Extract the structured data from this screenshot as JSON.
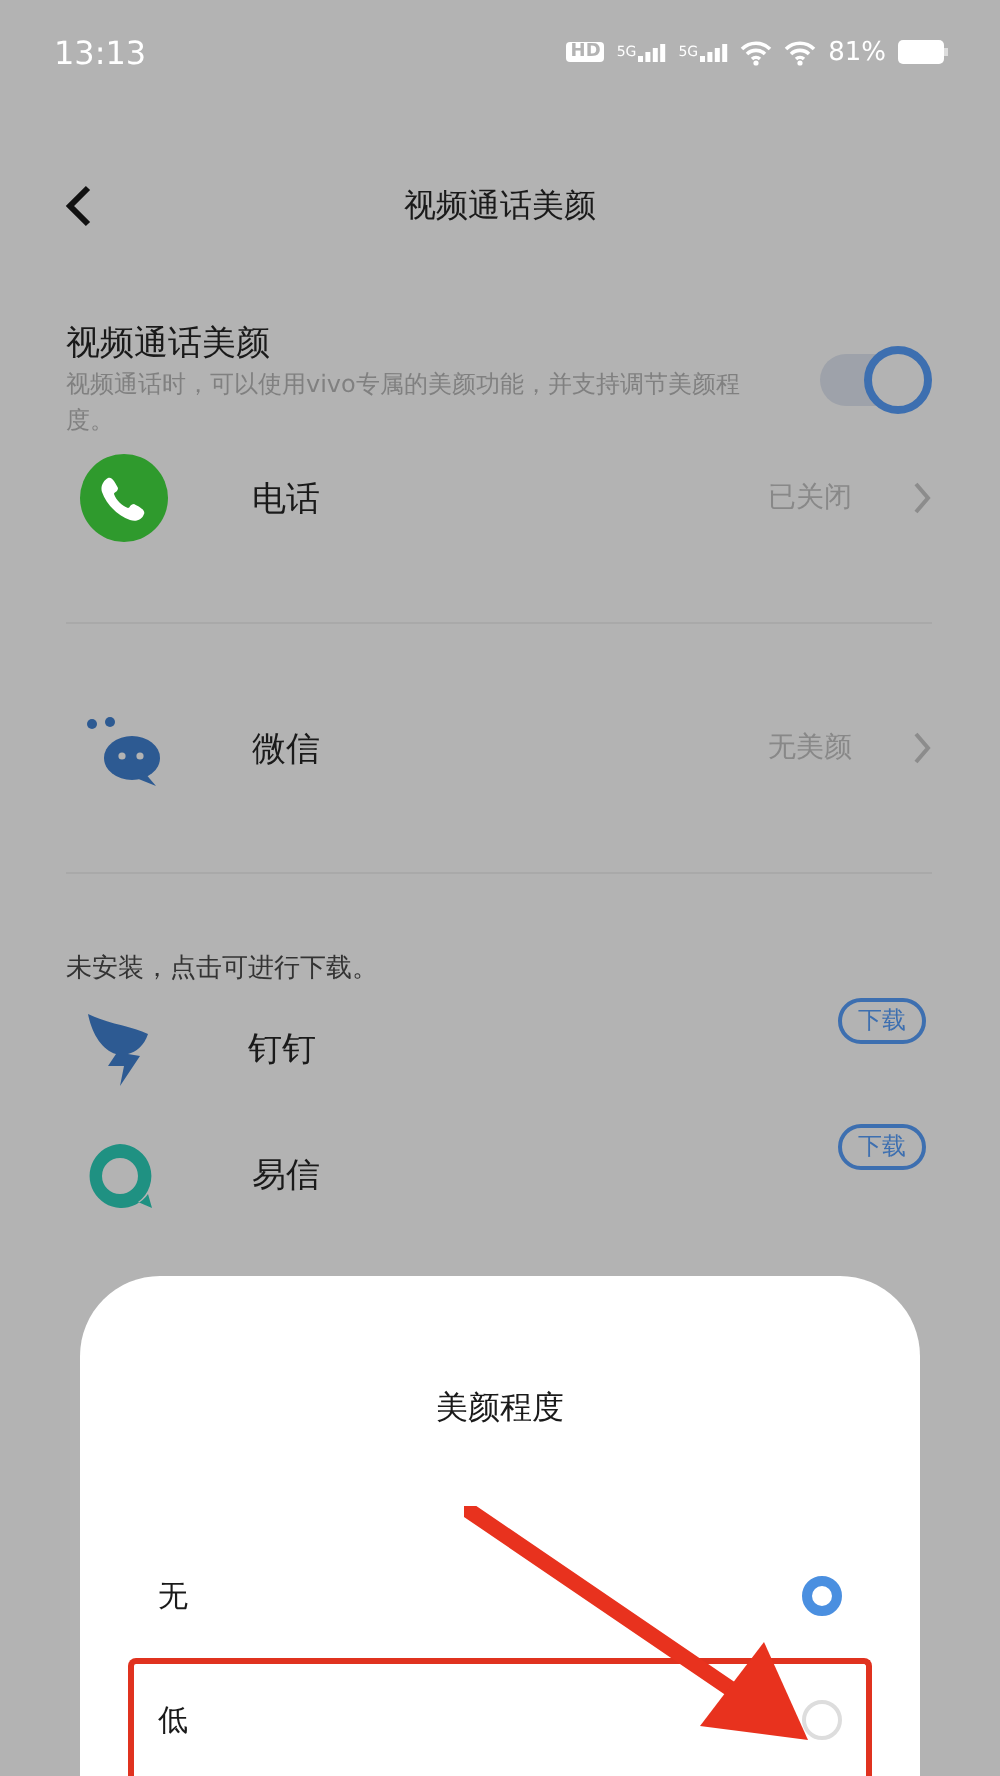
{
  "status_bar": {
    "time": "13:13",
    "hd": "HD",
    "networks": [
      "5G",
      "5G"
    ],
    "battery": "81%"
  },
  "header": {
    "title": "视频通话美颜"
  },
  "feature": {
    "title": "视频通话美颜",
    "description": "视频通话时，可以使用vivo专属的美颜功能，并支持调节美颜程度。",
    "on": true
  },
  "apps": [
    {
      "kind": "phone",
      "name": "电话",
      "status": "已关闭"
    },
    {
      "kind": "wechat",
      "name": "微信",
      "status": "无美颜"
    }
  ],
  "uninstalled": {
    "note": "未安装，点击可进行下载。",
    "apps": [
      {
        "kind": "dingtalk",
        "name": "钉钉",
        "button": "下载"
      },
      {
        "kind": "yixin",
        "name": "易信",
        "button": "下载"
      }
    ]
  },
  "dialog": {
    "title": "美颜程度",
    "options": [
      {
        "label": "无",
        "selected": true
      },
      {
        "label": "低",
        "selected": false,
        "highlighted": true
      }
    ]
  }
}
